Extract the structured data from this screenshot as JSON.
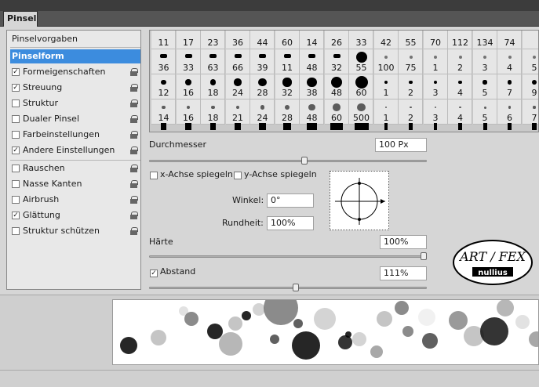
{
  "panel": {
    "tab_label": "Pinsel"
  },
  "left_panel": {
    "header": "Pinselvorgaben",
    "selected": "Pinselform",
    "options": [
      {
        "label": "Formeigenschaften",
        "checked": true
      },
      {
        "label": "Streuung",
        "checked": true
      },
      {
        "label": "Struktur",
        "checked": false
      },
      {
        "label": "Dualer Pinsel",
        "checked": false
      },
      {
        "label": "Farbeinstellungen",
        "checked": false
      },
      {
        "label": "Andere Einstellungen",
        "checked": true
      },
      {
        "label": "Rauschen",
        "checked": false
      },
      {
        "label": "Nasse Kanten",
        "checked": false
      },
      {
        "label": "Airbrush",
        "checked": false
      },
      {
        "label": "Glättung",
        "checked": true
      },
      {
        "label": "Struktur schützen",
        "checked": false
      }
    ]
  },
  "brush_grid": {
    "rows": [
      [
        "11",
        "17",
        "23",
        "36",
        "44",
        "60",
        "14",
        "26",
        "33",
        "42",
        "55",
        "70",
        "112",
        "134",
        "74",
        ""
      ],
      [
        "36",
        "33",
        "63",
        "66",
        "39",
        "11",
        "48",
        "32",
        "55",
        "100",
        "75",
        "1",
        "2",
        "3",
        "4",
        "5"
      ],
      [
        "12",
        "16",
        "18",
        "24",
        "28",
        "32",
        "38",
        "48",
        "60",
        "1",
        "2",
        "3",
        "4",
        "5",
        "7",
        "9"
      ],
      [
        "14",
        "16",
        "18",
        "21",
        "24",
        "28",
        "48",
        "60",
        "500",
        "1",
        "2",
        "3",
        "4",
        "5",
        "6",
        "7"
      ]
    ]
  },
  "diameter": {
    "label": "Durchmesser",
    "value": "100 Px",
    "slider_fraction": 0.56
  },
  "flip": {
    "x_label": "x-Achse spiegeln",
    "x_checked": false,
    "y_label": "y-Achse spiegeln",
    "y_checked": false
  },
  "angle": {
    "label": "Winkel:",
    "value": "0°"
  },
  "roundness": {
    "label": "Rundheit:",
    "value": "100%"
  },
  "hardness": {
    "label": "Härte",
    "value": "100%",
    "slider_fraction": 1.0
  },
  "spacing": {
    "label": "Abstand",
    "checked": true,
    "value": "111%",
    "slider_fraction": 0.53
  },
  "logo": {
    "text_top": "ART / FEX",
    "text_bottom": "nullius"
  },
  "colors": {
    "selected_bg": "#3c8cde",
    "panel_bg": "#d6d6d6"
  }
}
